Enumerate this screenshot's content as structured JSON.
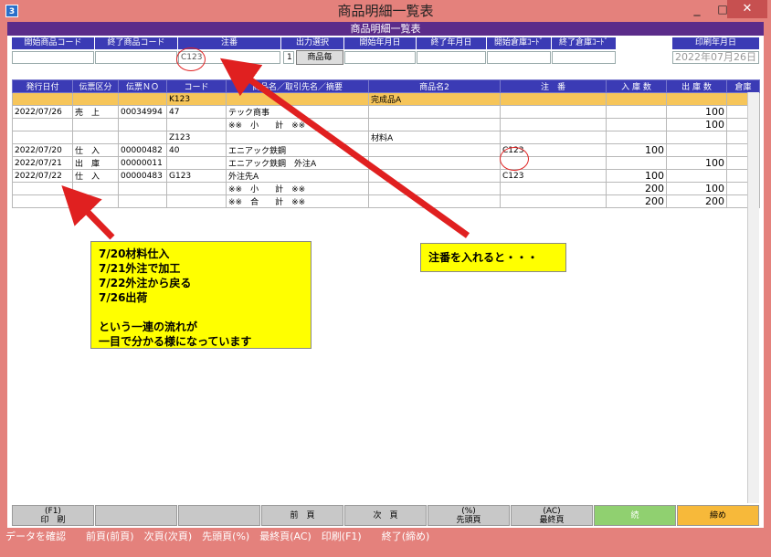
{
  "window": {
    "title": "商品明細一覧表",
    "subtitle": "商品明細一覧表",
    "app_icon": "3",
    "min_label": "_",
    "max_label": "□",
    "close_label": "✕"
  },
  "filters": {
    "start_item": {
      "label": "開始商品コード",
      "value": ""
    },
    "end_item": {
      "label": "終了商品コード",
      "value": ""
    },
    "order_no": {
      "label": "注番",
      "value": "C123"
    },
    "output": {
      "label": "出力選択",
      "value": "1",
      "button": "商品毎"
    },
    "start_date": {
      "label": "開始年月日",
      "value": ""
    },
    "end_date": {
      "label": "終了年月日",
      "value": ""
    },
    "start_wh": {
      "label": "開始倉庫ｺｰﾄﾞ",
      "value": ""
    },
    "end_wh": {
      "label": "終了倉庫ｺｰﾄﾞ",
      "value": ""
    },
    "print_date": {
      "label": "印刷年月日",
      "value": "2022年07月26日"
    }
  },
  "table": {
    "headers": [
      "発行日付",
      "伝票区分",
      "伝票ＮＯ",
      "コード",
      "商品名／取引先名／摘要",
      "商品名2",
      "注　番",
      "入 庫 数",
      "出 庫 数",
      "倉庫"
    ],
    "rows": [
      {
        "hl": true,
        "cells": [
          "",
          "",
          "",
          "K123",
          "",
          "完成品A",
          "",
          "",
          "",
          ""
        ]
      },
      {
        "hl": false,
        "cells": [
          "2022/07/26",
          "売　上",
          "00034994",
          "47",
          "テック商事",
          "",
          "",
          "",
          "100",
          ""
        ]
      },
      {
        "hl": false,
        "cells": [
          "",
          "",
          "",
          "",
          "※※　小　　計　※※",
          "",
          "",
          "",
          "100",
          ""
        ]
      },
      {
        "hl": false,
        "cells": [
          "",
          "",
          "",
          "Z123",
          "",
          "材料A",
          "",
          "",
          "",
          ""
        ]
      },
      {
        "hl": false,
        "cells": [
          "2022/07/20",
          "仕　入",
          "00000482",
          "40",
          "エニアック鉄鋼",
          "",
          "C123",
          "100",
          "",
          ""
        ]
      },
      {
        "hl": false,
        "cells": [
          "2022/07/21",
          "出　庫",
          "00000011",
          "",
          "エニアック鉄鋼　外注A",
          "",
          "",
          "",
          "100",
          ""
        ]
      },
      {
        "hl": false,
        "cells": [
          "2022/07/22",
          "仕　入",
          "00000483",
          "G123",
          "外注先A",
          "",
          "C123",
          "100",
          "",
          ""
        ]
      },
      {
        "hl": false,
        "cells": [
          "",
          "",
          "",
          "",
          "※※　小　　計　※※",
          "",
          "",
          "200",
          "100",
          ""
        ]
      },
      {
        "hl": false,
        "cells": [
          "",
          "",
          "",
          "",
          "※※　合　　計　※※",
          "",
          "",
          "200",
          "200",
          ""
        ]
      }
    ]
  },
  "annotations": {
    "left_lines": [
      "7/20材料仕入",
      "7/21外注で加工",
      "7/22外注から戻る",
      "7/26出荷",
      "",
      "という一連の流れが",
      "一目で分かる様になっています"
    ],
    "right_text": "注番を入れると・・・"
  },
  "buttons": [
    "(F1)\n印　刷",
    "",
    "",
    "前　頁",
    "次　頁",
    "(%)\n先頭頁",
    "(AC)\n最終頁",
    "続",
    "締め"
  ],
  "status": "データを確認　　前頁(前頁)　次頁(次頁)　先頭頁(%)　最終頁(AC)　印刷(F1)　　終了(締め)",
  "colors": {
    "header_blue": "#3b3bb5",
    "subtitle_purple": "#5b2c8a",
    "highlight_orange": "#f6c55a",
    "annotation_yellow": "#ffff00",
    "arrow_red": "#e02020",
    "close_red": "#c75050",
    "window_frame": "#e4817c"
  }
}
